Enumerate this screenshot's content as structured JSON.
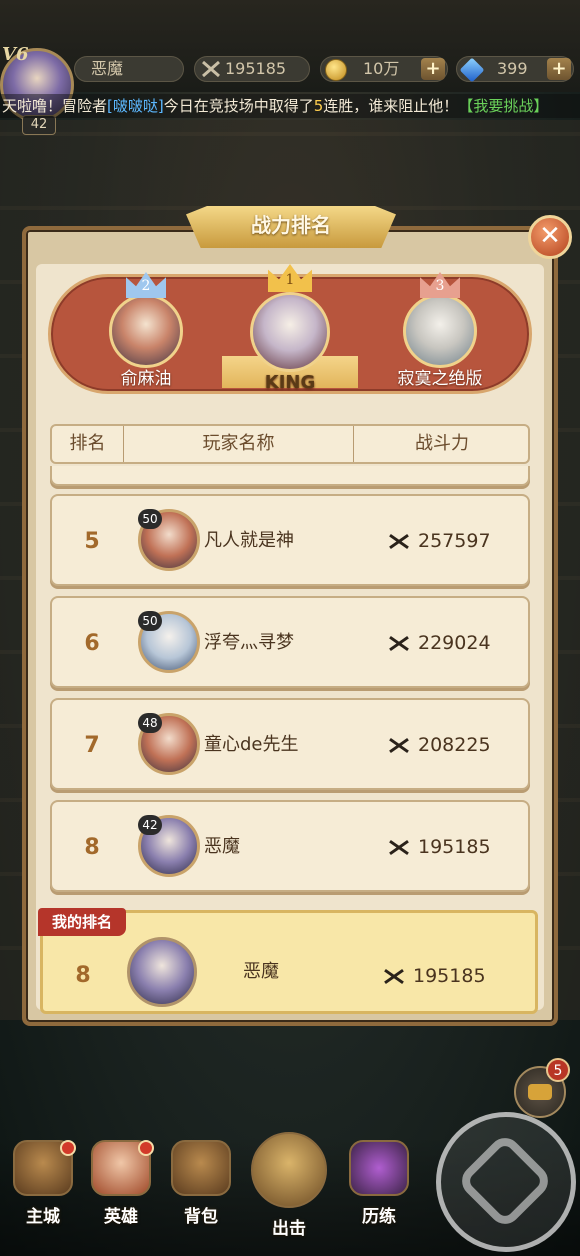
{
  "top_bar": {
    "vip": "V6",
    "level": "42",
    "player_name": "恶魔",
    "power": "195185",
    "gold": "10万",
    "gems": "399",
    "plus": "+"
  },
  "marquee": {
    "prefix": "天啦噜！冒险者",
    "player": "[啵啵哒]",
    "middle": "今日在竞技场中取得了",
    "wins": "5",
    "suffix": "连胜，谁来阻止他！",
    "challenge": "【我要挑战】"
  },
  "panel": {
    "title": "战力排名",
    "close": "✕"
  },
  "podium": [
    {
      "rank": "2",
      "name": "俞麻油",
      "crown_color": "#9fc7ee"
    },
    {
      "rank": "1",
      "name": "KING",
      "crown_color": "#f2c14b"
    },
    {
      "rank": "3",
      "name": "寂寞之绝版",
      "crown_color": "#e7a08f"
    }
  ],
  "table": {
    "headers": {
      "rank": "排名",
      "name": "玩家名称",
      "power": "战斗力"
    },
    "rows": [
      {
        "rank": "5",
        "level": "50",
        "name": "凡人就是神",
        "power": "257597"
      },
      {
        "rank": "6",
        "level": "50",
        "name": "浮夸灬寻梦",
        "power": "229024"
      },
      {
        "rank": "7",
        "level": "48",
        "name": "童心de先生",
        "power": "208225"
      },
      {
        "rank": "8",
        "level": "42",
        "name": "恶魔",
        "power": "195185"
      }
    ]
  },
  "my_rank": {
    "tag": "我的排名",
    "rank": "8",
    "name": "恶魔",
    "power": "195185"
  },
  "chat": {
    "badge": "5"
  },
  "nav": [
    {
      "label": "主城",
      "icon": "castle-icon",
      "badge": true
    },
    {
      "label": "英雄",
      "icon": "hero-icon",
      "badge": true
    },
    {
      "label": "背包",
      "icon": "backpack-icon",
      "badge": false
    },
    {
      "label": "出击",
      "icon": "crossed-swords-icon",
      "badge": false
    },
    {
      "label": "历练",
      "icon": "portal-icon",
      "badge": false
    }
  ]
}
